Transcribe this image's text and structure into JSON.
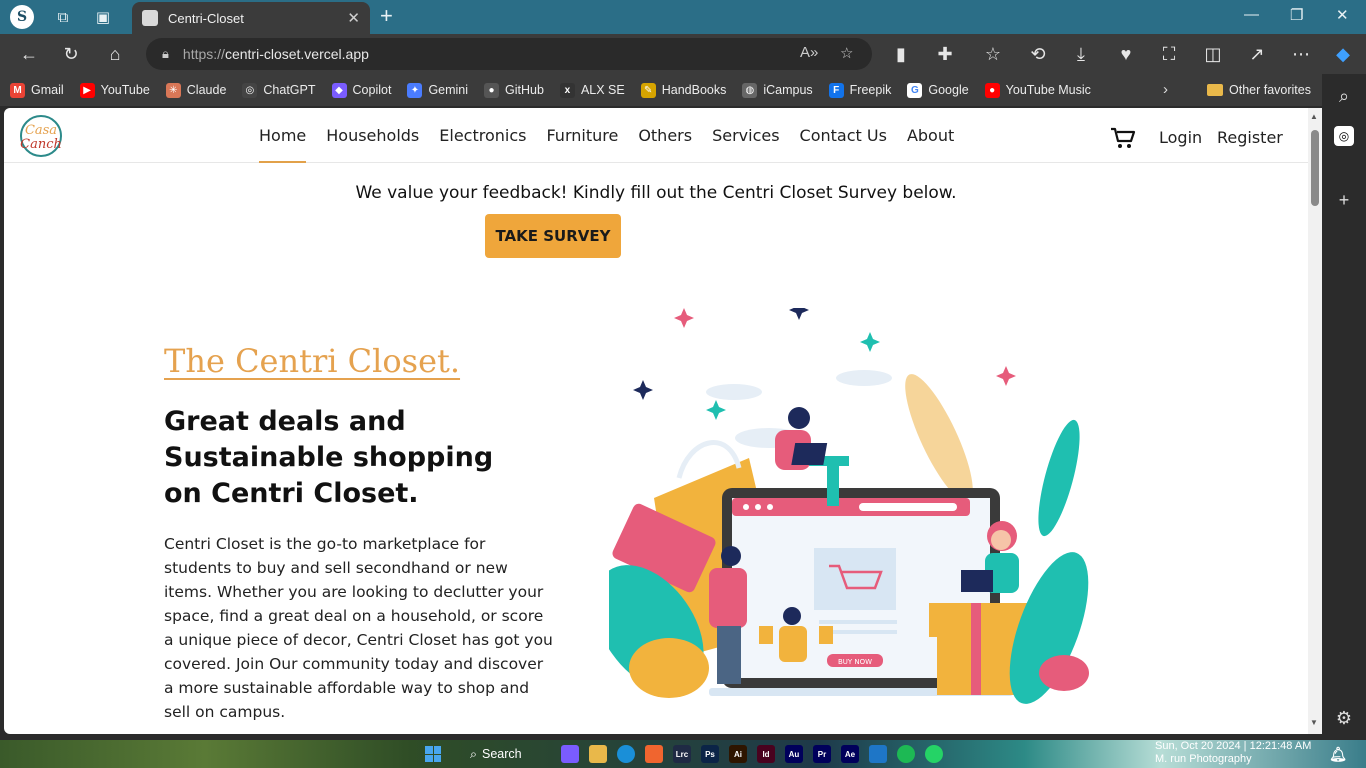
{
  "browser": {
    "tab_title": "Centri-Closet",
    "url_protocol": "https://",
    "url_host": "centri-closet.vercel.app"
  },
  "bookmarks": [
    {
      "label": "Gmail",
      "color": "#ea4335",
      "glyph": "M"
    },
    {
      "label": "YouTube",
      "color": "#ff0000",
      "glyph": "▶"
    },
    {
      "label": "Claude",
      "color": "#d97757",
      "glyph": "✳"
    },
    {
      "label": "ChatGPT",
      "color": "#444444",
      "glyph": "◎"
    },
    {
      "label": "Copilot",
      "color": "#7a5cff",
      "glyph": "◆"
    },
    {
      "label": "Gemini",
      "color": "#4a7cff",
      "glyph": "✦"
    },
    {
      "label": "GitHub",
      "color": "#555555",
      "glyph": "●"
    },
    {
      "label": "ALX SE",
      "color": "#333333",
      "glyph": "x"
    },
    {
      "label": "HandBooks",
      "color": "#d6a400",
      "glyph": "✎"
    },
    {
      "label": "iCampus",
      "color": "#666666",
      "glyph": "◍"
    },
    {
      "label": "Freepik",
      "color": "#1273eb",
      "glyph": "F"
    },
    {
      "label": "Google",
      "color": "#ffffff",
      "glyph": "G"
    },
    {
      "label": "YouTube Music",
      "color": "#ff0000",
      "glyph": "●"
    }
  ],
  "other_favorites": "Other favorites",
  "site": {
    "logo_text": "Casa Canch",
    "nav": [
      {
        "label": "Home",
        "active": true
      },
      {
        "label": "Households",
        "active": false
      },
      {
        "label": "Electronics",
        "active": false
      },
      {
        "label": "Furniture",
        "active": false
      },
      {
        "label": "Others",
        "active": false
      },
      {
        "label": "Services",
        "active": false
      },
      {
        "label": "Contact Us",
        "active": false
      },
      {
        "label": "About",
        "active": false
      }
    ],
    "login": "Login",
    "register": "Register",
    "survey_text": "We value your feedback! Kindly fill out the Centri Closet Survey below.",
    "survey_button": "TAKE SURVEY",
    "brand": "The Centri Closet.",
    "headline": "Great deals and Sustainable shopping on Centri Closet.",
    "description": "Centri Closet is the go-to marketplace for students to buy and sell secondhand or new items. Whether you are looking to declutter your space, find a great deal on a household, or score a unique piece of decor, Centri Closet has got you covered. Join Our community today and discover a more sustainable affordable way to shop and sell on campus.",
    "illustration_button": "BUY NOW",
    "accent_color": "#e5a24f"
  },
  "taskbar": {
    "search_label": "Search",
    "date": "Sun, Oct 20 2024 | 12:21:48 AM",
    "wallpaper_credit": "M. run Photography"
  }
}
